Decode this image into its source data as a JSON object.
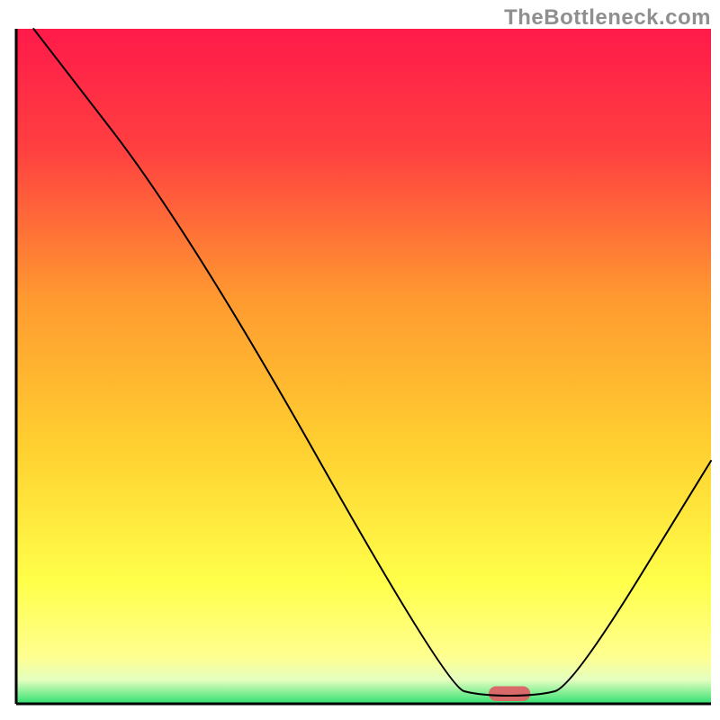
{
  "watermark": "TheBottleneck.com",
  "chart_data": {
    "type": "line",
    "title": "",
    "xlabel": "",
    "ylabel": "",
    "xlim": [
      0,
      100
    ],
    "ylim": [
      0,
      100
    ],
    "gradient_stops": [
      {
        "offset": 0.0,
        "color": "#ff1a4a"
      },
      {
        "offset": 0.18,
        "color": "#ff4040"
      },
      {
        "offset": 0.4,
        "color": "#ff9a30"
      },
      {
        "offset": 0.62,
        "color": "#ffd030"
      },
      {
        "offset": 0.82,
        "color": "#ffff4a"
      },
      {
        "offset": 0.93,
        "color": "#ffff90"
      },
      {
        "offset": 0.965,
        "color": "#e4ffc0"
      },
      {
        "offset": 1.0,
        "color": "#30e070"
      }
    ],
    "curve": {
      "name": "bottleneck-curve",
      "points": [
        {
          "x": 2.5,
          "y": 100
        },
        {
          "x": 25,
          "y": 70
        },
        {
          "x": 62,
          "y": 2.5
        },
        {
          "x": 67,
          "y": 1.2
        },
        {
          "x": 75,
          "y": 1.2
        },
        {
          "x": 80,
          "y": 2.5
        },
        {
          "x": 100,
          "y": 36
        }
      ]
    },
    "marker": {
      "x": 71,
      "y": 1.5,
      "width": 6,
      "height": 2.2,
      "color": "#d86a6a"
    },
    "axes_color": "#000000",
    "curve_color": "#000000",
    "curve_width": 2
  }
}
